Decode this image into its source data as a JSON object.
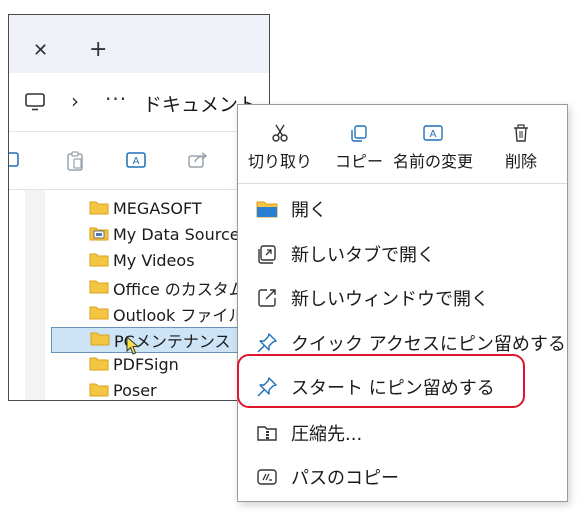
{
  "explorer": {
    "tab_close_icon": "close-icon",
    "new_tab_icon": "plus-icon",
    "address": {
      "chevron": "›",
      "overflow": "···",
      "crumb": "ドキュメント"
    },
    "tree": [
      {
        "label": "MEGASOFT",
        "icon": "folder-icon"
      },
      {
        "label": "My Data Sources",
        "icon": "data-folder-icon"
      },
      {
        "label": "My Videos",
        "icon": "folder-icon"
      },
      {
        "label": "Office のカスタム",
        "icon": "folder-icon"
      },
      {
        "label": "Outlook ファイル",
        "icon": "folder-icon"
      },
      {
        "label": "PCメンテナンス",
        "icon": "folder-icon",
        "selected": true
      },
      {
        "label": "PDFSign",
        "icon": "folder-icon"
      },
      {
        "label": "Poser",
        "icon": "folder-icon"
      }
    ]
  },
  "context_menu": {
    "quick_actions": [
      {
        "label": "切り取り",
        "icon": "scissors-icon"
      },
      {
        "label": "コピー",
        "icon": "copy-icon"
      },
      {
        "label": "名前の変更",
        "icon": "rename-icon"
      },
      {
        "label": "削除",
        "icon": "trash-icon"
      }
    ],
    "items": [
      {
        "label": "開く",
        "icon": "folder-open-icon"
      },
      {
        "label": "新しいタブで開く",
        "icon": "new-tab-icon"
      },
      {
        "label": "新しいウィンドウで開く",
        "icon": "new-window-icon"
      },
      {
        "label": "クイック アクセスにピン留めする",
        "icon": "pin-icon"
      },
      {
        "label": "スタート にピン留めする",
        "icon": "pin-icon"
      },
      {
        "label": "圧縮先...",
        "icon": "zip-icon"
      },
      {
        "label": "パスのコピー",
        "icon": "copy-path-icon"
      }
    ],
    "highlight_color": "#e0152d"
  }
}
